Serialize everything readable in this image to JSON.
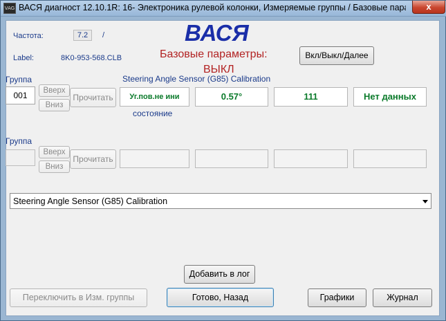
{
  "window": {
    "title": "ВАСЯ диагност 12.10.1R: 16- Электроника рулевой колонки,  Измеряемые группы / Базовые параме...",
    "close_label": "x",
    "app_icon": "vasya-icon"
  },
  "header": {
    "freq_label": "Частота:",
    "freq_value": "7.2",
    "freq_slash": "/",
    "label_caption": "Label:",
    "label_value": "8K0-953-568.CLB",
    "brand": "ВАСЯ",
    "mode_line1": "Базовые параметры:",
    "mode_line2": "ВЫКЛ",
    "toggle_button": "Вкл/Выкл/Далее"
  },
  "group1": {
    "caption": "Группа",
    "number": "001",
    "up_label": "Вверх",
    "down_label": "Вниз",
    "read_label": "Прочитать",
    "title": "Steering Angle Sensor (G85) Calibration",
    "cells": [
      "Уг.пов.не ини",
      "0.57°",
      "111",
      "Нет данных"
    ],
    "cell_caption": "состояние"
  },
  "group2": {
    "caption": "Группа",
    "number": "",
    "up_label": "Вверх",
    "down_label": "Вниз",
    "read_label": "Прочитать"
  },
  "dropdown": {
    "selected": "Steering Angle Sensor (G85) Calibration",
    "arrow_icon": "chevron-down-icon"
  },
  "footer": {
    "log_button": "Добавить в лог",
    "switch_button": "Переключить в Изм. группы",
    "done_button": "Готово, Назад",
    "graphs_button": "Графики",
    "journal_button": "Журнал"
  },
  "colors": {
    "brand": "#1a2ea8",
    "mode": "#b22222",
    "value_text": "#0a7a2a",
    "caption": "#1a3a8a"
  }
}
